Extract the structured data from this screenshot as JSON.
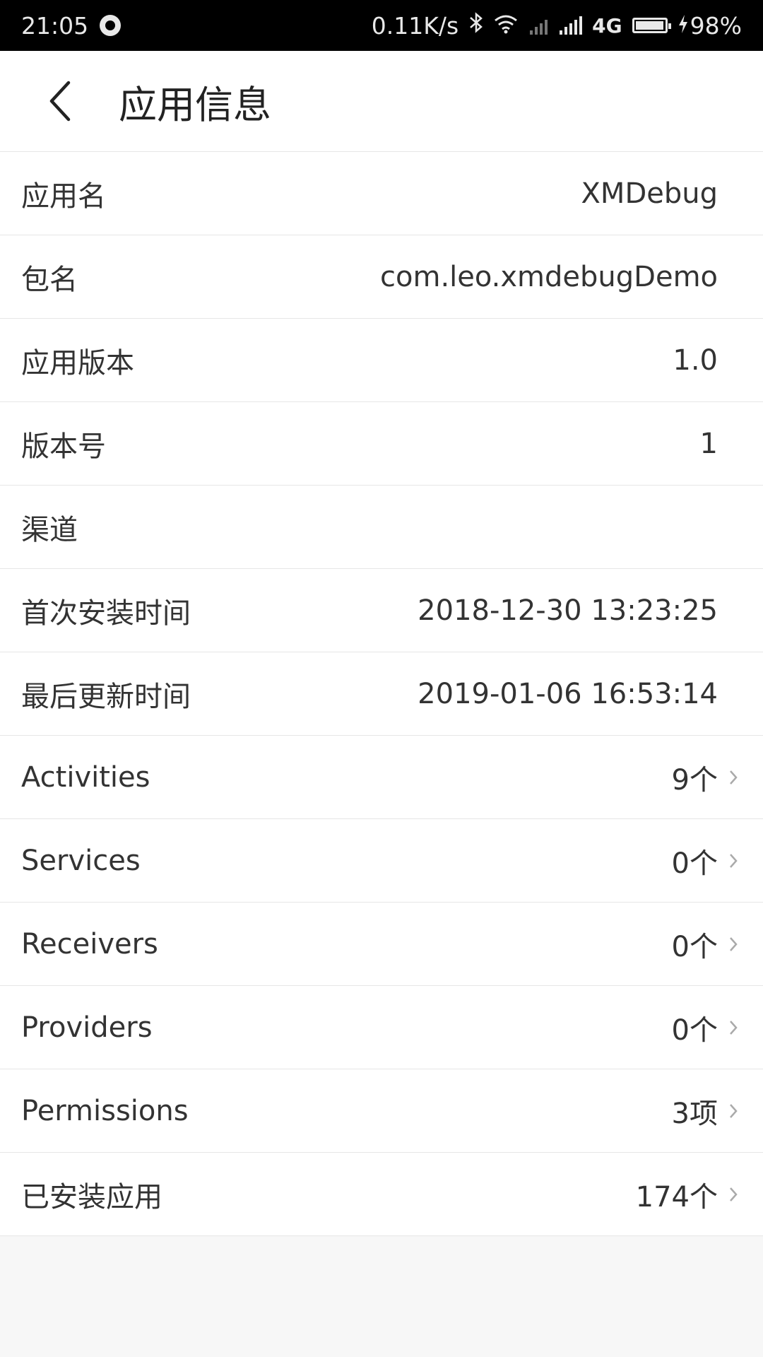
{
  "statusbar": {
    "time": "21:05",
    "speed": "0.11K/s",
    "network": "4G",
    "battery_pct": "98%",
    "battery_level": 0.98,
    "icons": [
      "record-icon",
      "bluetooth-icon",
      "wifi-icon",
      "signal-icon",
      "charging-icon"
    ]
  },
  "header": {
    "title": "应用信息"
  },
  "info_rows": [
    {
      "label": "应用名",
      "value": "XMDebug"
    },
    {
      "label": "包名",
      "value": "com.leo.xmdebugDemo"
    },
    {
      "label": "应用版本",
      "value": "1.0"
    },
    {
      "label": "版本号",
      "value": "1"
    },
    {
      "label": "渠道",
      "value": ""
    },
    {
      "label": "首次安装时间",
      "value": "2018-12-30 13:23:25"
    },
    {
      "label": "最后更新时间",
      "value": "2019-01-06 16:53:14"
    }
  ],
  "link_rows": [
    {
      "label": "Activities",
      "value": "9个"
    },
    {
      "label": "Services",
      "value": "0个"
    },
    {
      "label": "Receivers",
      "value": "0个"
    },
    {
      "label": "Providers",
      "value": "0个"
    },
    {
      "label": "Permissions",
      "value": "3项"
    },
    {
      "label": "已安装应用",
      "value": "174个"
    }
  ]
}
